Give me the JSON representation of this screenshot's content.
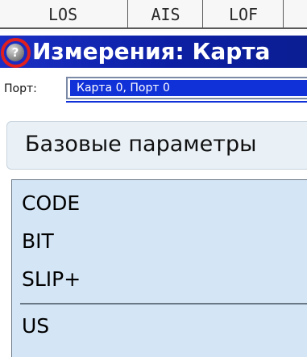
{
  "alarm_tabs": [
    "LOS",
    "AIS",
    "LOF"
  ],
  "title_bar": {
    "help_icon": "question-mark-icon",
    "help_glyph": "?",
    "highlight_color": "#e01f1f",
    "title": "Измерения: Карта"
  },
  "port": {
    "label": "Порт:",
    "selected_value": "Карта 0, Порт 0"
  },
  "section": {
    "title": "Базовые параметры"
  },
  "measurements": {
    "group1": [
      "CODE",
      "BIT",
      "SLIP+"
    ],
    "group2": [
      "US"
    ]
  },
  "colors": {
    "title_bar": "#1b2fc4",
    "selection": "#1030d8",
    "panel": "#d4e5f5"
  }
}
